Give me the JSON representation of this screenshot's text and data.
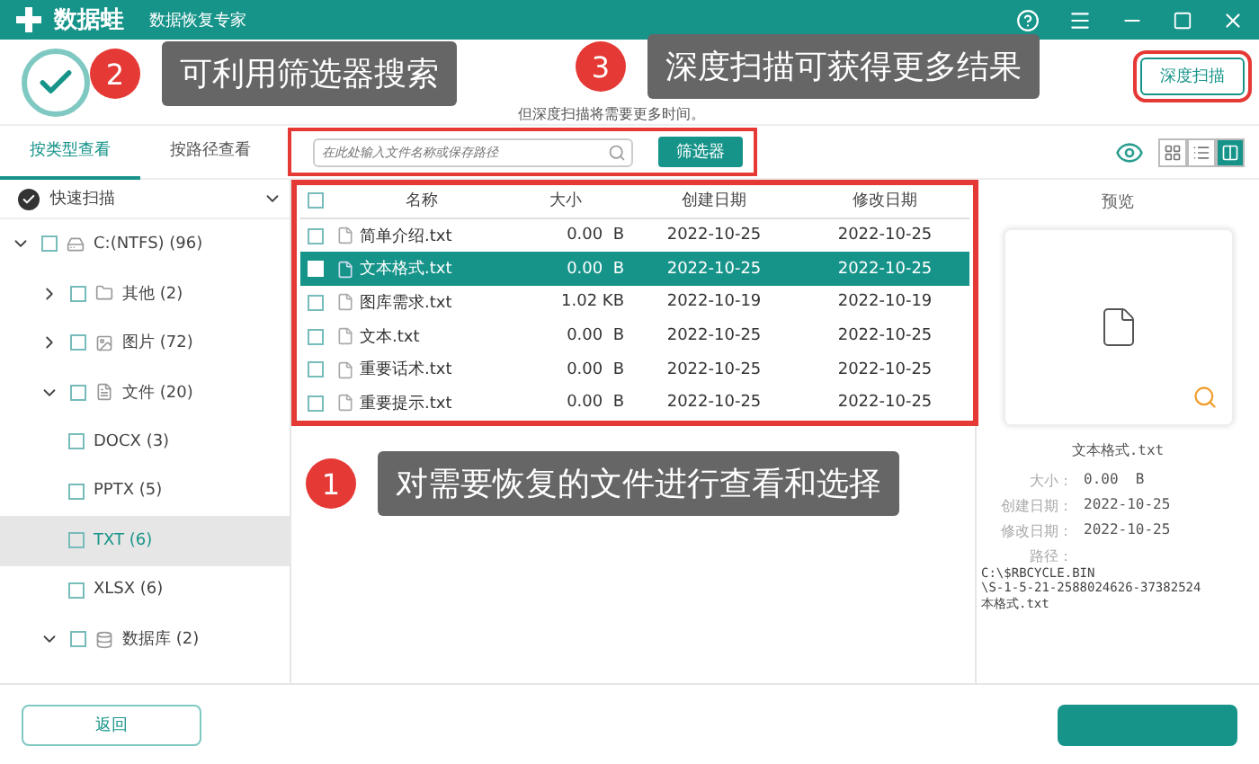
{
  "window": {
    "app_name": "数据蛙",
    "subtitle": "数据恢复专家"
  },
  "header": {
    "note": "但深度扫描将需要更多时间。",
    "deep_scan_button": "深度扫描"
  },
  "view_tabs": [
    {
      "label": "按类型查看",
      "selected": true
    },
    {
      "label": "按路径查看",
      "selected": false
    }
  ],
  "search": {
    "placeholder": "在此处输入文件名称或保存路径"
  },
  "filter_button": "筛选器",
  "view_modes": [
    {
      "kind": "grid",
      "selected": false
    },
    {
      "kind": "list",
      "selected": false
    },
    {
      "kind": "detail",
      "selected": true
    }
  ],
  "sidebar": {
    "scan_mode": "快速扫描",
    "tree": [
      {
        "label": "C:(NTFS) (96)",
        "kind": "drive",
        "expanded": true,
        "checked": false,
        "selected": false,
        "children": [
          {
            "label": "其他 (2)",
            "kind": "folder",
            "expanded": false,
            "checked": false,
            "selected": false
          },
          {
            "label": "图片 (72)",
            "kind": "image",
            "expanded": false,
            "checked": false,
            "selected": false
          },
          {
            "label": "文件 (20)",
            "kind": "file",
            "expanded": true,
            "checked": false,
            "selected": false,
            "children": [
              {
                "label": "DOCX (3)",
                "checked": false,
                "selected": false
              },
              {
                "label": "PPTX (5)",
                "checked": false,
                "selected": false
              },
              {
                "label": "TXT (6)",
                "checked": false,
                "selected": true
              },
              {
                "label": "XLSX (6)",
                "checked": false,
                "selected": false
              }
            ]
          },
          {
            "label": "数据库 (2)",
            "kind": "database",
            "expanded": true,
            "checked": false,
            "selected": false
          }
        ]
      }
    ]
  },
  "table": {
    "all_checked": false,
    "columns": [
      "名称",
      "大小",
      "创建日期",
      "修改日期"
    ],
    "rows": [
      {
        "name": "简单介绍.txt",
        "size": "0.00  B",
        "created": "2022-10-25",
        "modified": "2022-10-25",
        "checked": false,
        "selected": false
      },
      {
        "name": "文本格式.txt",
        "size": "0.00  B",
        "created": "2022-10-25",
        "modified": "2022-10-25",
        "checked": false,
        "selected": true
      },
      {
        "name": "图库需求.txt",
        "size": "1.02 KB",
        "created": "2022-10-19",
        "modified": "2022-10-19",
        "checked": false,
        "selected": false
      },
      {
        "name": "文本.txt",
        "size": "0.00  B",
        "created": "2022-10-25",
        "modified": "2022-10-25",
        "checked": false,
        "selected": false
      },
      {
        "name": "重要话术.txt",
        "size": "0.00  B",
        "created": "2022-10-25",
        "modified": "2022-10-25",
        "checked": false,
        "selected": false
      },
      {
        "name": "重要提示.txt",
        "size": "0.00  B",
        "created": "2022-10-25",
        "modified": "2022-10-25",
        "checked": false,
        "selected": false
      }
    ]
  },
  "preview": {
    "title": "预览",
    "file_name": "文本格式.txt",
    "fields": [
      {
        "label": "大小：",
        "value": "0.00  B"
      },
      {
        "label": "创建日期：",
        "value": "2022-10-25"
      },
      {
        "label": "修改日期：",
        "value": "2022-10-25"
      },
      {
        "label": "路径："
      }
    ],
    "path_lines": [
      "C:\\$RBCYCLE.BIN",
      "\\S-1-5-21-2588024626-37382524",
      "本格式.txt"
    ]
  },
  "footer": {
    "back_button": "返回"
  },
  "callouts": [
    {
      "number": "2",
      "text": "可利用筛选器搜索"
    },
    {
      "number": "3",
      "text": "深度扫描可获得更多结果"
    },
    {
      "number": "1",
      "text": "对需要恢复的文件进行查看和选择"
    }
  ]
}
